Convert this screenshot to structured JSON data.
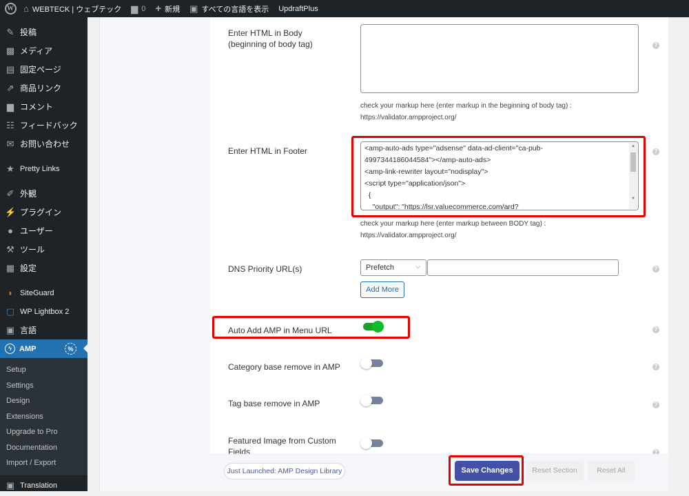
{
  "adminbar": {
    "wp_logo": "W",
    "site_name": "WEBTECK | ウェブテック",
    "comments_count": "0",
    "new_label": "新規",
    "languages_label": "すべての言語を表示",
    "updraft_label": "UpdraftPlus"
  },
  "sidebar": {
    "items": [
      {
        "label": "投稿",
        "icon": "pin-icon"
      },
      {
        "label": "メディア",
        "icon": "media-icon"
      },
      {
        "label": "固定ページ",
        "icon": "pages-icon"
      },
      {
        "label": "商品リンク",
        "icon": "share-icon"
      },
      {
        "label": "コメント",
        "icon": "comment-icon"
      },
      {
        "label": "フィードバック",
        "icon": "feedback-icon"
      },
      {
        "label": "お問い合わせ",
        "icon": "mail-icon"
      },
      {
        "label": "Pretty Links",
        "icon": "star-icon"
      },
      {
        "label": "外観",
        "icon": "brush-icon"
      },
      {
        "label": "プラグイン",
        "icon": "plugin-icon"
      },
      {
        "label": "ユーザー",
        "icon": "user-icon"
      },
      {
        "label": "ツール",
        "icon": "wrench-icon"
      },
      {
        "label": "設定",
        "icon": "settings-icon"
      },
      {
        "label": "SiteGuard",
        "icon": "shield-icon"
      },
      {
        "label": "WP Lightbox 2",
        "icon": "lightbox-icon"
      },
      {
        "label": "言語",
        "icon": "translate-icon"
      },
      {
        "label": "AMP",
        "icon": "amp-icon"
      }
    ],
    "submenu": [
      "Setup",
      "Settings",
      "Design",
      "Extensions",
      "Upgrade to Pro",
      "Documentation",
      "Import / Export"
    ],
    "translation_label": "Translation",
    "amp_badge": "%"
  },
  "form": {
    "body_html": {
      "label_line1": "Enter HTML in Body",
      "label_line2": "(beginning of body tag)",
      "value": "",
      "hint_line1": "check your markup here (enter markup in the beginning of body tag) :",
      "hint_line2": "https://validator.ampproject.org/"
    },
    "footer_html": {
      "label": "Enter HTML in Footer",
      "value": "<amp-auto-ads type=\"adsense\" data-ad-client=\"ca-pub-\n4997344186044584\"></amp-auto-ads>\n<amp-link-rewriter layout=\"nodisplay\">\n<script type=\"application/json\">\n  {\n    \"output\": \"https://lsr.valuecommerce.com/ard?",
      "hint_line1": "check your markup here (enter markup between BODY tag) :",
      "hint_line2": "https://validator.ampproject.org/"
    },
    "dns": {
      "label": "DNS Priority URL(s)",
      "select_value": "Prefetch",
      "url_value": "",
      "add_more_label": "Add More"
    },
    "toggles": [
      {
        "label": "Auto Add AMP in Menu URL",
        "on": true
      },
      {
        "label": "Category base remove in AMP",
        "on": false
      },
      {
        "label": "Tag base remove in AMP",
        "on": false
      },
      {
        "label_line1": "Featured Image from Custom",
        "label_line2": "Fields",
        "on": false
      }
    ],
    "help_glyph": "?"
  },
  "footer": {
    "launch_label": "Just Launched: AMP Design Library",
    "save_label": "Save Changes",
    "reset_section_label": "Reset Section",
    "reset_all_label": "Reset All"
  },
  "colors": {
    "accent": "#2271b1",
    "save_button": "#4350a6",
    "toggle_on": "#0dbe26",
    "highlight": "#e50000"
  }
}
